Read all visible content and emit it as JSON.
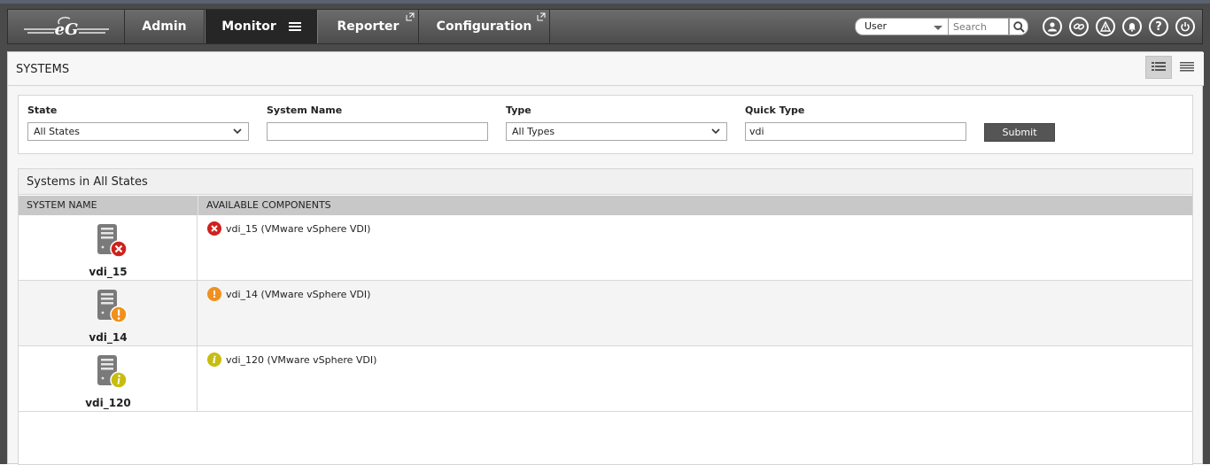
{
  "nav": {
    "logo_text": "eG",
    "tabs": [
      {
        "label": "Admin"
      },
      {
        "label": "Monitor"
      },
      {
        "label": "Reporter"
      },
      {
        "label": "Configuration"
      }
    ],
    "user_select": "User",
    "search_placeholder": "Search",
    "icons": [
      "user-icon",
      "link-icon",
      "alert-triangle-icon",
      "bell-icon",
      "help-icon",
      "power-icon"
    ]
  },
  "page": {
    "title": "SYSTEMS"
  },
  "filters": {
    "state_label": "State",
    "state_value": "All States",
    "system_name_label": "System Name",
    "system_name_value": "",
    "type_label": "Type",
    "type_value": "All Types",
    "quick_type_label": "Quick Type",
    "quick_type_value": "vdi",
    "submit_label": "Submit"
  },
  "systems": {
    "panel_title": "Systems in All States",
    "col_system": "SYSTEM NAME",
    "col_components": "AVAILABLE COMPONENTS",
    "rows": [
      {
        "name": "vdi_15",
        "status": "critical",
        "component": "vdi_15 (VMware vSphere VDI)"
      },
      {
        "name": "vdi_14",
        "status": "major",
        "component": "vdi_14 (VMware vSphere VDI)"
      },
      {
        "name": "vdi_120",
        "status": "minor",
        "component": "vdi_120 (VMware vSphere VDI)"
      }
    ]
  },
  "colors": {
    "critical": "#d0211c",
    "major": "#f0901e",
    "minor": "#c7bd10",
    "nav_active": "#262626",
    "submit": "#555555"
  }
}
